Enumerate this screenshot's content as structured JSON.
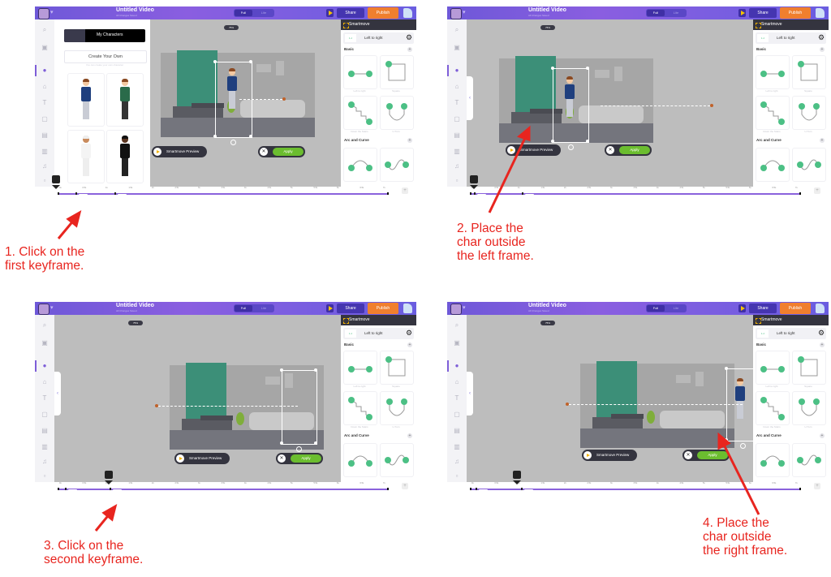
{
  "app": {
    "title": "Untitled Video",
    "subtitle": "All Changes Saved",
    "toggle": {
      "on": "Full",
      "off": "Lite"
    },
    "share_label": "Share",
    "publish_label": "Publish",
    "zoom_chip": "75%"
  },
  "char_panel": {
    "tab_label": "My Characters",
    "create_label": "Create Your Own",
    "create_sub": "You can create your own character"
  },
  "canvas": {
    "preview_label": "Smartmove Preview",
    "apply_label": "Apply"
  },
  "right_panel": {
    "header": "Smartmove",
    "selected": "Left to right",
    "sections": [
      "Basic",
      "Arc and Curve"
    ],
    "moves": [
      "Left to right",
      "Square",
      "Down the Stairs",
      "U-Turn"
    ]
  },
  "timeline": {
    "ticks": [
      "0s",
      "0.5s",
      "1s",
      "1.5s",
      "2s",
      "2.5s",
      "3s",
      "3.5s",
      "4s",
      "4.5s",
      "5s",
      "5.5s",
      "6s",
      "6.5s",
      "7s"
    ],
    "zoom_label": "Zoom"
  },
  "annotations": {
    "step1": [
      "1. Click on the",
      "first keyframe."
    ],
    "step2": [
      "2. Place the",
      "char outside",
      "the left frame."
    ],
    "step3": [
      "3. Click on the",
      "second keyframe."
    ],
    "step4": [
      "4. Place the",
      "char outside",
      "the right frame."
    ]
  },
  "colors": {
    "brand_purple": "#7e5ed8",
    "publish_orange": "#f07f2e",
    "apply_green": "#6bbd2f",
    "annotation_red": "#e8251f",
    "track_purple": "#8a62dc"
  }
}
